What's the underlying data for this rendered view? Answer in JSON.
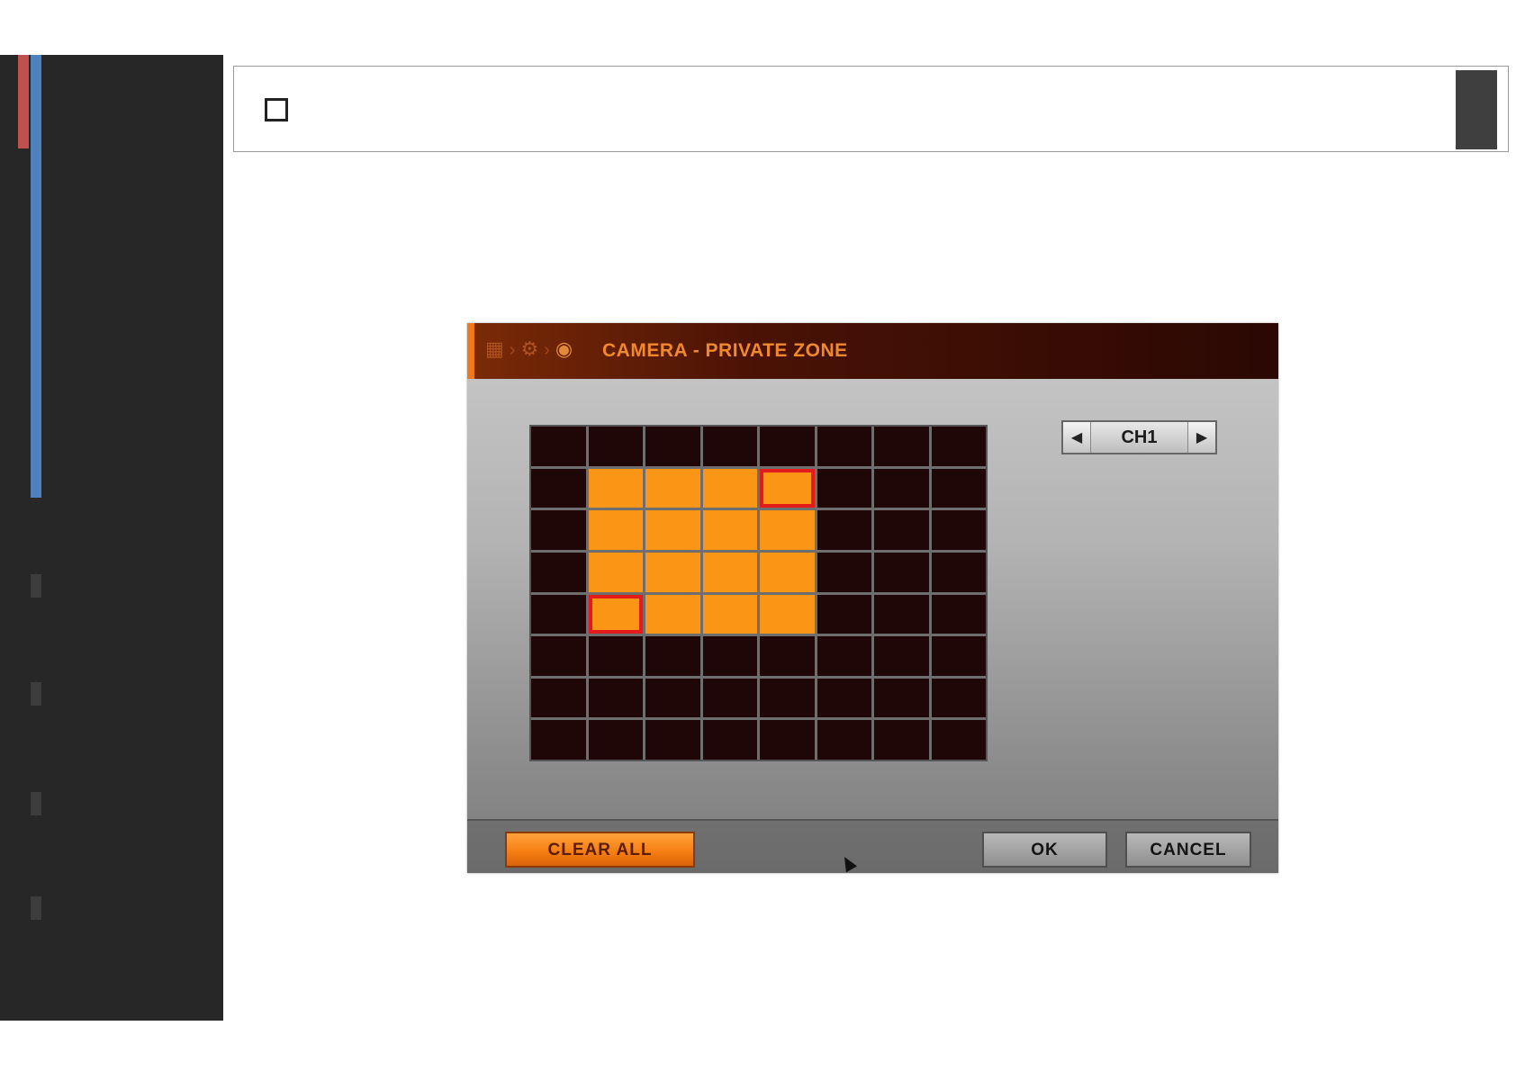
{
  "dialog": {
    "title": "CAMERA - PRIVATE ZONE",
    "breadcrumb_icons": [
      "grid-icon",
      "gear-icon",
      "camera-icon"
    ],
    "channel": {
      "value": "CH1"
    },
    "grid": {
      "rows": 8,
      "cols": 8,
      "selected_cells": [
        [
          1,
          1
        ],
        [
          1,
          2
        ],
        [
          1,
          3
        ],
        [
          1,
          4
        ],
        [
          2,
          1
        ],
        [
          2,
          2
        ],
        [
          2,
          3
        ],
        [
          2,
          4
        ],
        [
          3,
          1
        ],
        [
          3,
          2
        ],
        [
          3,
          3
        ],
        [
          3,
          4
        ],
        [
          4,
          1
        ],
        [
          4,
          2
        ],
        [
          4,
          3
        ],
        [
          4,
          4
        ]
      ],
      "highlighted_cells": [
        [
          1,
          4
        ],
        [
          4,
          1
        ]
      ]
    },
    "buttons": {
      "clear_all": "CLEAR ALL",
      "ok": "OK",
      "cancel": "CANCEL"
    }
  },
  "colors": {
    "selected_cell": "#fb9515",
    "empty_cell": "#1f0707",
    "highlight": "#e51a1a",
    "title": "#f0892d",
    "sidebar": "#272727",
    "sidebar_red": "#c0504d",
    "sidebar_blue": "#4f81bd"
  }
}
